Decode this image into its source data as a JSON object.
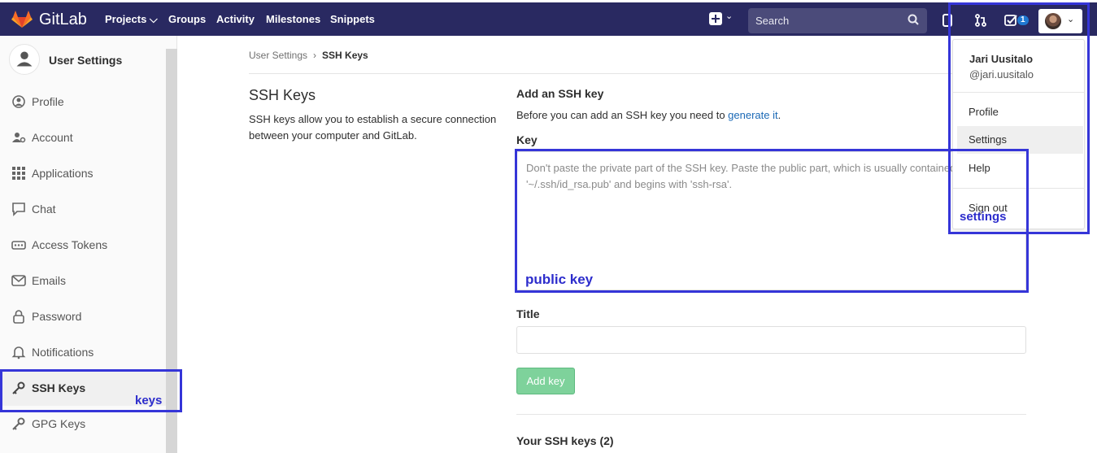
{
  "navbar": {
    "brand": "GitLab",
    "links": [
      "Projects ⌵",
      "Groups",
      "Activity",
      "Milestones",
      "Snippets"
    ],
    "search_placeholder": "Search",
    "todo_count": "1",
    "colors": {
      "background": "#292961",
      "badge": "#1f78d1"
    }
  },
  "sidebar": {
    "title": "User Settings",
    "items": [
      {
        "label": "Profile",
        "icon": "profile-icon"
      },
      {
        "label": "Account",
        "icon": "account-icon"
      },
      {
        "label": "Applications",
        "icon": "applications-icon"
      },
      {
        "label": "Chat",
        "icon": "chat-icon"
      },
      {
        "label": "Access Tokens",
        "icon": "access-tokens-icon"
      },
      {
        "label": "Emails",
        "icon": "email-icon"
      },
      {
        "label": "Password",
        "icon": "lock-icon"
      },
      {
        "label": "Notifications",
        "icon": "bell-icon"
      },
      {
        "label": "SSH Keys",
        "icon": "key-icon"
      },
      {
        "label": "GPG Keys",
        "icon": "key-icon"
      }
    ]
  },
  "breadcrumb": {
    "parent": "User Settings",
    "current": "SSH Keys"
  },
  "main": {
    "section_title": "SSH Keys",
    "section_description": "SSH keys allow you to establish a secure connection between your computer and GitLab.",
    "add_title": "Add an SSH key",
    "add_description_prefix": "Before you can add an SSH key you need to ",
    "add_description_link": "generate it",
    "add_description_suffix": ".",
    "key_label": "Key",
    "key_placeholder": "Don't paste the private part of the SSH key. Paste the public part, which is usually contained in the file '~/.ssh/id_rsa.pub' and begins with 'ssh-rsa'.",
    "title_label": "Title",
    "title_value": "",
    "add_button": "Add key",
    "your_keys_label": "Your SSH keys (2)",
    "colors": {
      "add_button": "#7ed29b",
      "link": "#1b69b6"
    }
  },
  "user_dropdown": {
    "name": "Jari Uusitalo",
    "handle": "@jari.uusitalo",
    "items": [
      "Profile",
      "Settings",
      "Help",
      "Sign out"
    ]
  },
  "annotations": {
    "settings": "settings",
    "public_key": "public key",
    "keys": "keys",
    "color": "#3535d8"
  }
}
